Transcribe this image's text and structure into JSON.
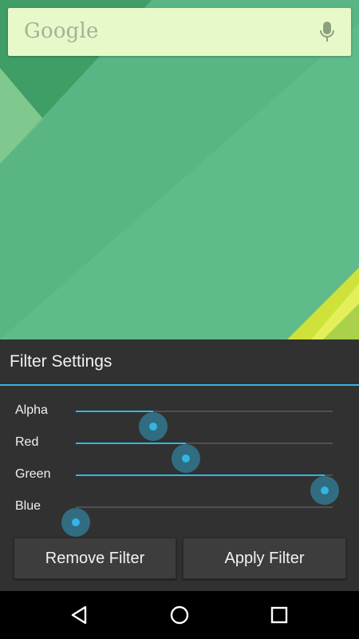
{
  "search": {
    "logo_text": "Google",
    "mic_icon": "mic-icon"
  },
  "dialog": {
    "title": "Filter Settings",
    "accent_color": "#33b5e5",
    "sliders": [
      {
        "label": "Alpha",
        "value_fraction": 0.3
      },
      {
        "label": "Red",
        "value_fraction": 0.43
      },
      {
        "label": "Green",
        "value_fraction": 0.97
      },
      {
        "label": "Blue",
        "value_fraction": 0.0
      }
    ],
    "buttons": {
      "remove_label": "Remove Filter",
      "apply_label": "Apply Filter"
    }
  },
  "navbar": {
    "back_icon": "back-icon",
    "home_icon": "home-icon",
    "recents_icon": "recents-icon"
  }
}
